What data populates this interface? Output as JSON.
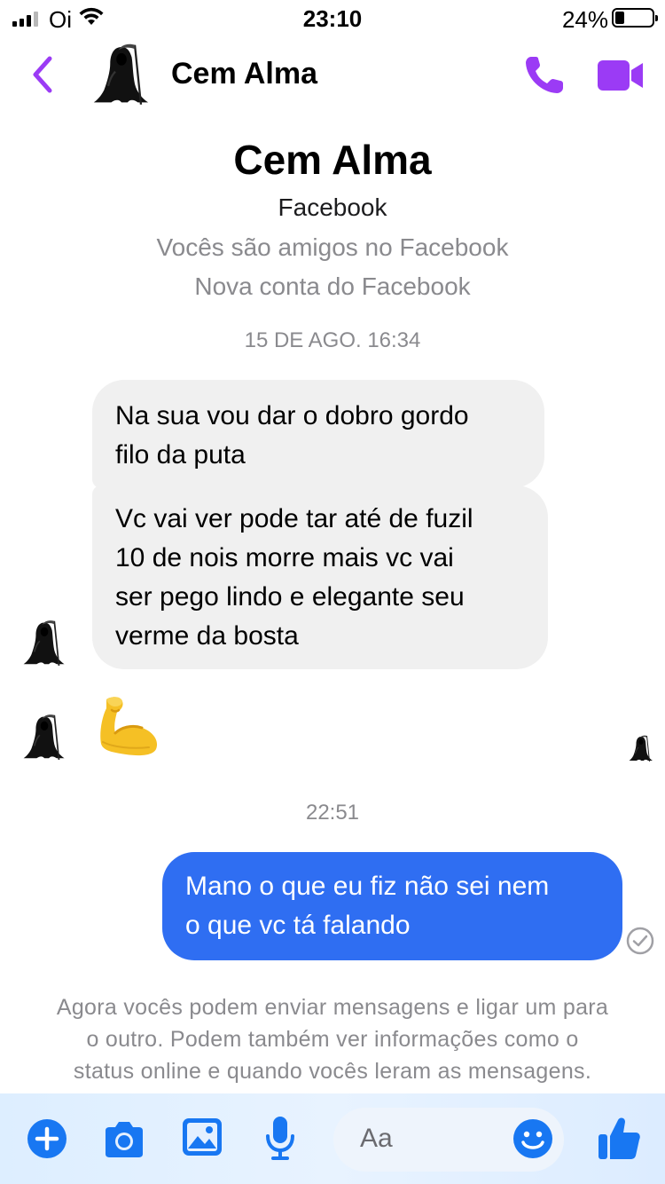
{
  "status_bar": {
    "carrier": "Oi",
    "time": "23:10",
    "battery_percent": "24%",
    "battery_level": 0.24
  },
  "header": {
    "contact_name": "Cem Alma",
    "back_icon": "chevron-left-icon",
    "call_icon": "phone-icon",
    "video_icon": "video-camera-icon"
  },
  "profile": {
    "name": "Cem Alma",
    "platform": "Facebook",
    "friend_status": "Vocês são amigos no Facebook",
    "account_note": "Nova conta do Facebook"
  },
  "conversation": {
    "timestamp_1": "15 DE AGO. 16:34",
    "incoming": [
      {
        "lines": [
          "Na sua vou dar o dobro gordo",
          "filo da puta"
        ]
      },
      {
        "lines": [
          "Vc vai ver pode tar até de fuzil",
          "10 de nois morre mais vc vai",
          "ser pego lindo e elegante seu",
          "verme da bosta"
        ]
      }
    ],
    "emoji": "flexed-biceps",
    "timestamp_2": "22:51",
    "outgoing": [
      {
        "lines": [
          "Mano o que eu fiz não sei nem",
          "o que vc tá falando"
        ],
        "status": "delivered"
      }
    ],
    "notice_lines": [
      "Agora vocês podem enviar mensagens e ligar um para",
      "o outro. Podem também ver informações como o",
      "status online e quando vocês leram as mensagens."
    ]
  },
  "composer": {
    "placeholder": "Aa",
    "icons": [
      "plus-icon",
      "camera-icon",
      "photo-icon",
      "microphone-icon",
      "emoji-icon",
      "thumbs-up-icon"
    ]
  },
  "colors": {
    "accent": "#9b3bf5",
    "outgoing_bubble": "#2f6ef2",
    "incoming_bubble": "#f0f0f0",
    "composer_icon": "#1877f2"
  }
}
